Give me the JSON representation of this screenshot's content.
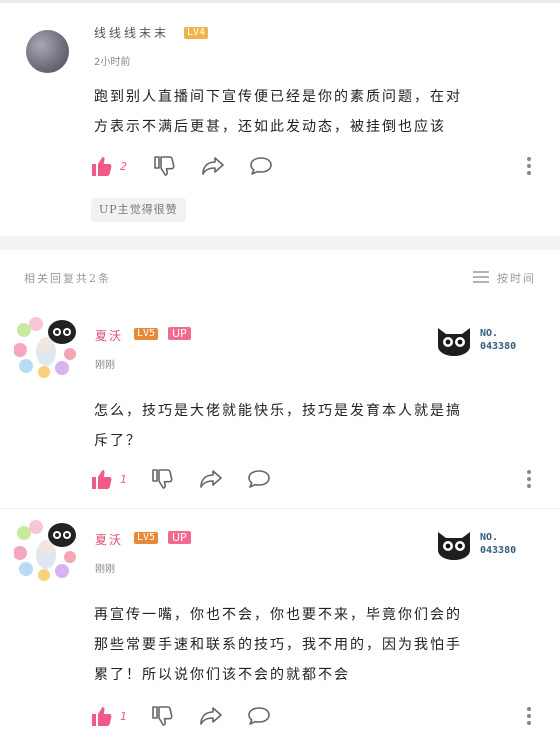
{
  "main_post": {
    "username": "线线线末末",
    "level": "LV4",
    "time": "2小时前",
    "text_line1": "跑到别人直播间下宣传便已经是你的素质问题，在对",
    "text_line2": "方表示不满后更甚，还如此发动态，被挂倒也应该",
    "like_count": "2",
    "tag": "UP主觉得很赞"
  },
  "replies_header": {
    "count_text": "相关回复共2条",
    "sort_label": "按时间"
  },
  "replies": [
    {
      "username": "夏沃",
      "level": "LV5",
      "up_label": "UP",
      "time": "刚刚",
      "no_label": "NO.",
      "no_number": "043380",
      "text_line1": "怎么，技巧是大佬就能快乐，技巧是发育本人就是搞",
      "text_line2": "斥了？",
      "like_count": "1"
    },
    {
      "username": "夏沃",
      "level": "LV5",
      "up_label": "UP",
      "time": "刚刚",
      "no_label": "NO.",
      "no_number": "043380",
      "text_line1": "再宣传一嘴，你也不会，你也要不来，毕竟你们会的",
      "text_line2": "那些常要手速和联系的技巧，我不用的，因为我怕手",
      "text_line3": "累了！所以说你们该不会的就都不会",
      "like_count": "1"
    }
  ],
  "icons": {
    "like": "thumb-up-icon",
    "dislike": "thumb-down-icon",
    "share": "share-icon",
    "comment": "comment-icon",
    "more": "more-vertical-icon",
    "sort": "sort-lines-icon",
    "badge": "black-cat-badge-icon"
  },
  "colors": {
    "like_active": "#f05a86",
    "up_badge": "#f26b8f",
    "lv5_badge": "#e8893a",
    "lv4_badge": "#f1b34a",
    "reply_name": "#e05070"
  }
}
